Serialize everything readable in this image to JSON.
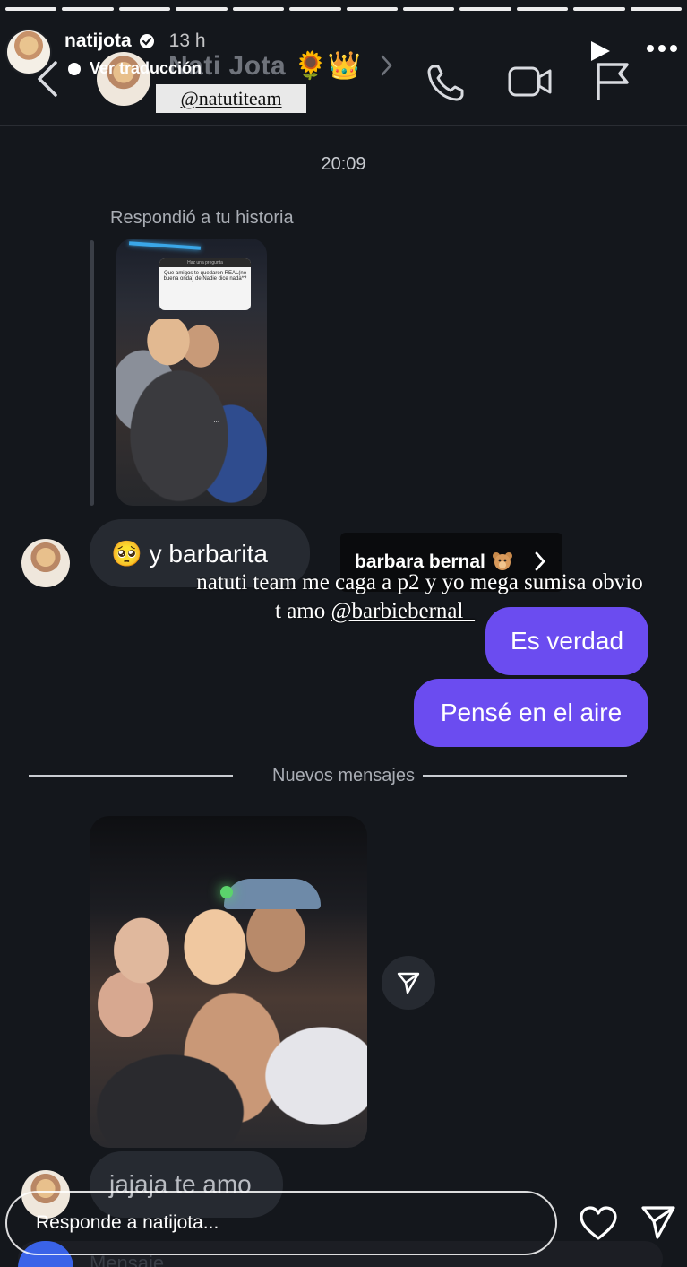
{
  "story": {
    "username": "natijota",
    "time": "13 h",
    "translate": "Ver traducción",
    "progress_segments": 12
  },
  "dm": {
    "contact_name": "Nati Jota 🌻👑",
    "mention_top": "@natutiteam",
    "timestamp": "20:09",
    "reply_label": "Respondió a tu historia",
    "story_card_head": "Haz una pregunta",
    "story_card_text": "Que amigos te quedaron REAL(no buena onda) de Nadie dice nada*?",
    "story_caption": "..."
  },
  "messages": {
    "in_1": "🥺 y barbarita",
    "out_1": "Es verdad",
    "out_2": "Pensé en el aire",
    "divider_label": "Nuevos mensajes",
    "in_2": "jajaja te amo"
  },
  "tag": {
    "label": "barbara bernal"
  },
  "caption": {
    "line1": "natuti team me caga a p2 y yo mega sumisa obvio",
    "line2_prefix": "t amo ",
    "line2_mention": "@barbiebernal_"
  },
  "footer": {
    "reply_placeholder": "Responde a natijota...",
    "ghost_text": "Mensaje..."
  },
  "colors": {
    "background": "#14171c",
    "outgoing_bubble": "#6b4cf0",
    "incoming_bubble": "#262a31"
  }
}
